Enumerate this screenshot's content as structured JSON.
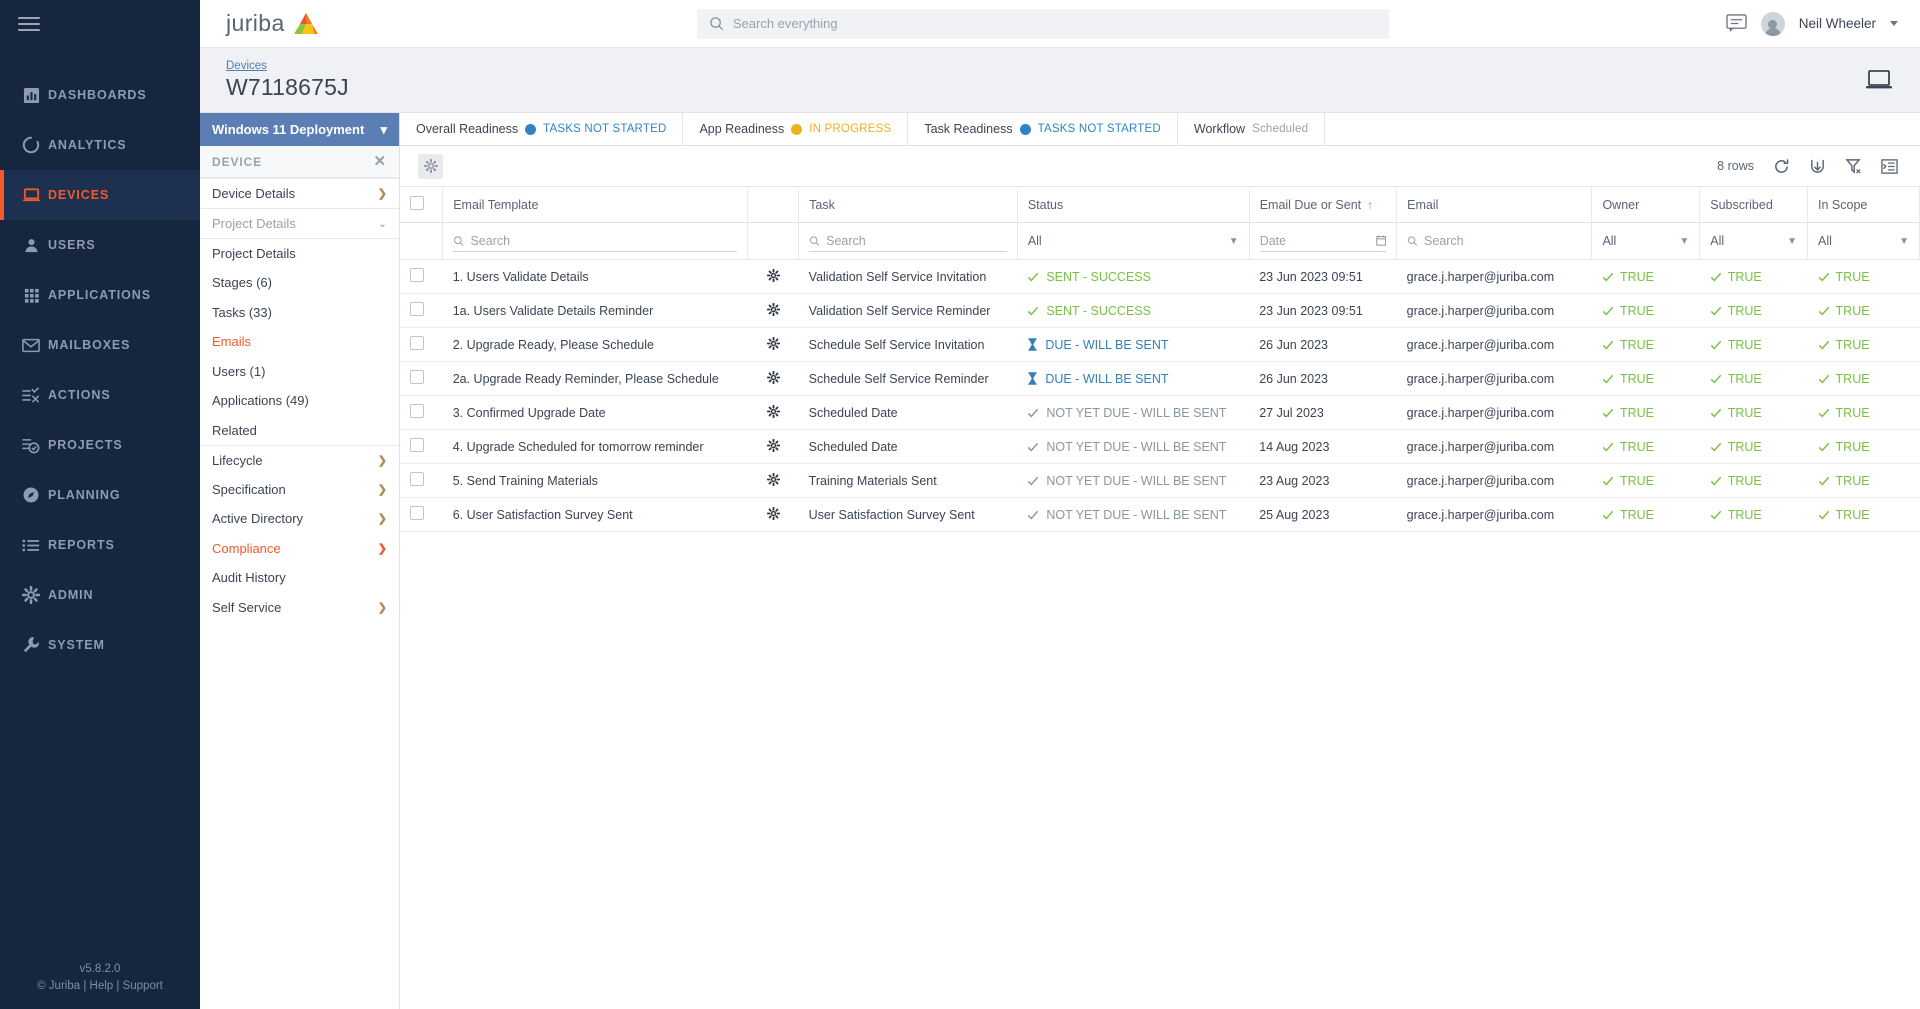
{
  "brand": {
    "name": "juriba"
  },
  "topbar": {
    "search_placeholder": "Search everything",
    "user_name": "Neil Wheeler"
  },
  "rail": {
    "items": [
      {
        "label": "DASHBOARDS",
        "icon": "chart-icon",
        "active": false
      },
      {
        "label": "ANALYTICS",
        "icon": "analytics-icon",
        "active": false
      },
      {
        "label": "DEVICES",
        "icon": "laptop-icon",
        "active": true
      },
      {
        "label": "USERS",
        "icon": "user-icon",
        "active": false
      },
      {
        "label": "APPLICATIONS",
        "icon": "grid-icon",
        "active": false
      },
      {
        "label": "MAILBOXES",
        "icon": "envelope-icon",
        "active": false
      },
      {
        "label": "ACTIONS",
        "icon": "actions-icon",
        "active": false
      },
      {
        "label": "PROJECTS",
        "icon": "projects-icon",
        "active": false
      },
      {
        "label": "PLANNING",
        "icon": "compass-icon",
        "active": false
      },
      {
        "label": "REPORTS",
        "icon": "list-icon",
        "active": false
      },
      {
        "label": "ADMIN",
        "icon": "gear-icon",
        "active": false
      },
      {
        "label": "SYSTEM",
        "icon": "wrench-icon",
        "active": false
      }
    ],
    "version": "v5.8.2.0",
    "copyright": "© Juriba",
    "help": "Help",
    "support": "Support",
    "sep1": "|",
    "sep2": "|"
  },
  "title": {
    "breadcrumb": "Devices",
    "heading": "W7118675J",
    "device_icon": "laptop-icon"
  },
  "panel": {
    "project": "Windows 11 Deployment",
    "section": "DEVICE",
    "items": [
      {
        "label": "Device Details",
        "kind": "sect",
        "chev": ">"
      },
      {
        "label": "Project Details",
        "kind": "group",
        "chev": "v"
      },
      {
        "label": "Project Details",
        "kind": "sub",
        "chev": ""
      },
      {
        "label": "Stages (6)",
        "kind": "sub",
        "chev": ""
      },
      {
        "label": "Tasks (33)",
        "kind": "sub",
        "chev": ""
      },
      {
        "label": "Emails",
        "kind": "sub-alert",
        "chev": ""
      },
      {
        "label": "Users (1)",
        "kind": "sub",
        "chev": ""
      },
      {
        "label": "Applications (49)",
        "kind": "sub",
        "chev": ""
      },
      {
        "label": "Related",
        "kind": "sub",
        "chev": ""
      },
      {
        "label": "Lifecycle",
        "kind": "sect",
        "chev": ">"
      },
      {
        "label": "Specification",
        "kind": "plain",
        "chev": ">"
      },
      {
        "label": "Active Directory",
        "kind": "plain",
        "chev": ">"
      },
      {
        "label": "Compliance",
        "kind": "alert",
        "chev": ">"
      },
      {
        "label": "Audit History",
        "kind": "plain",
        "chev": ""
      },
      {
        "label": "Self Service",
        "kind": "plain",
        "chev": ">"
      }
    ]
  },
  "tabs": [
    {
      "label": "Overall Readiness",
      "value": "TASKS NOT STARTED",
      "dot": "blue",
      "value_class": "v-blue"
    },
    {
      "label": "App Readiness",
      "value": "IN PROGRESS",
      "dot": "amber",
      "value_class": "v-amber"
    },
    {
      "label": "Task Readiness",
      "value": "TASKS NOT STARTED",
      "dot": "blue",
      "value_class": "v-blue"
    },
    {
      "label": "Workflow",
      "value": "Scheduled",
      "dot": "none",
      "value_class": "v-grey"
    }
  ],
  "toolbar": {
    "settings_icon": "gear-icon",
    "row_count": "8 rows",
    "refresh_icon": "refresh-icon",
    "export_icon": "export-icon",
    "clear_filter_icon": "clear-filter-icon",
    "columns_icon": "columns-icon"
  },
  "table": {
    "columns": [
      {
        "key": "check",
        "label": ""
      },
      {
        "key": "template",
        "label": "Email Template"
      },
      {
        "key": "gear",
        "label": ""
      },
      {
        "key": "task",
        "label": "Task"
      },
      {
        "key": "status",
        "label": "Status"
      },
      {
        "key": "due",
        "label": "Email Due or Sent",
        "sorted": "asc",
        "sort_glyph": "↑"
      },
      {
        "key": "email",
        "label": "Email"
      },
      {
        "key": "owner",
        "label": "Owner"
      },
      {
        "key": "subscribed",
        "label": "Subscribed"
      },
      {
        "key": "inscope",
        "label": "In Scope"
      }
    ],
    "filters": {
      "template": "Search",
      "task": "Search",
      "status": "All",
      "due": "Date",
      "email": "Search",
      "owner": "All",
      "subscribed": "All",
      "inscope": "All"
    },
    "rows": [
      {
        "template": "1. Users Validate Details",
        "task": "Validation Self Service Invitation",
        "status": "SENT - SUCCESS",
        "status_kind": "ok",
        "status_icon": "check-icon",
        "due": "23 Jun 2023 09:51",
        "email": "grace.j.harper@juriba.com",
        "owner": "TRUE",
        "subscribed": "TRUE",
        "inscope": "TRUE"
      },
      {
        "template": "1a. Users Validate Details Reminder",
        "task": "Validation Self Service Reminder",
        "status": "SENT - SUCCESS",
        "status_kind": "ok",
        "status_icon": "check-icon",
        "due": "23 Jun 2023 09:51",
        "email": "grace.j.harper@juriba.com",
        "owner": "TRUE",
        "subscribed": "TRUE",
        "inscope": "TRUE"
      },
      {
        "template": "2. Upgrade Ready, Please Schedule",
        "task": "Schedule Self Service Invitation",
        "status": "DUE - WILL BE SENT",
        "status_kind": "due",
        "status_icon": "hourglass-icon",
        "due": "26 Jun 2023",
        "email": "grace.j.harper@juriba.com",
        "owner": "TRUE",
        "subscribed": "TRUE",
        "inscope": "TRUE"
      },
      {
        "template": "2a. Upgrade Ready Reminder, Please Schedule",
        "task": "Schedule Self Service Reminder",
        "status": "DUE - WILL BE SENT",
        "status_kind": "due",
        "status_icon": "hourglass-icon",
        "due": "26 Jun 2023",
        "email": "grace.j.harper@juriba.com",
        "owner": "TRUE",
        "subscribed": "TRUE",
        "inscope": "TRUE"
      },
      {
        "template": "3. Confirmed Upgrade Date",
        "task": "Scheduled Date",
        "status": "NOT YET DUE - WILL BE SENT",
        "status_kind": "pend",
        "status_icon": "check-icon",
        "due": "27 Jul 2023",
        "email": "grace.j.harper@juriba.com",
        "owner": "TRUE",
        "subscribed": "TRUE",
        "inscope": "TRUE"
      },
      {
        "template": "4. Upgrade Scheduled for tomorrow reminder",
        "task": "Scheduled Date",
        "status": "NOT YET DUE - WILL BE SENT",
        "status_kind": "pend",
        "status_icon": "check-icon",
        "due": "14 Aug 2023",
        "email": "grace.j.harper@juriba.com",
        "owner": "TRUE",
        "subscribed": "TRUE",
        "inscope": "TRUE"
      },
      {
        "template": "5. Send Training Materials",
        "task": "Training Materials Sent",
        "status": "NOT YET DUE - WILL BE SENT",
        "status_kind": "pend",
        "status_icon": "check-icon",
        "due": "23 Aug 2023",
        "email": "grace.j.harper@juriba.com",
        "owner": "TRUE",
        "subscribed": "TRUE",
        "inscope": "TRUE"
      },
      {
        "template": "6. User Satisfaction Survey Sent",
        "task": "User Satisfaction Survey Sent",
        "status": "NOT YET DUE - WILL BE SENT",
        "status_kind": "pend",
        "status_icon": "check-icon",
        "due": "25 Aug 2023",
        "email": "grace.j.harper@juriba.com",
        "owner": "TRUE",
        "subscribed": "TRUE",
        "inscope": "TRUE"
      }
    ]
  },
  "colors": {
    "accent": "#f15a29",
    "rail_bg": "#16263f",
    "panel_header": "#5b7fb5",
    "success": "#7ac143",
    "due": "#3380b5",
    "pending": "#8996a5",
    "amber": "#efb11d",
    "info_blue": "#2f85c4"
  }
}
